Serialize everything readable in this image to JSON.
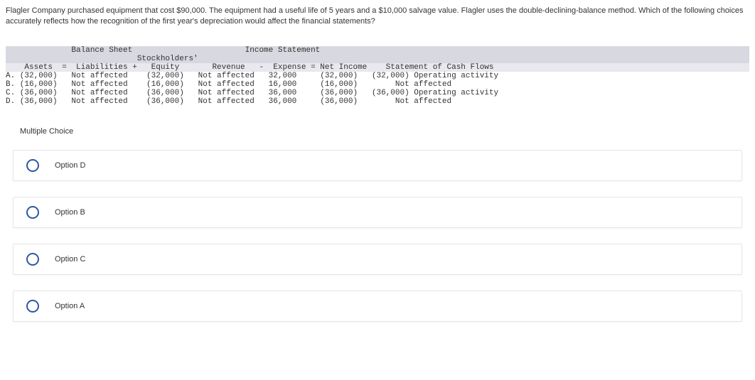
{
  "question": "Flagler Company purchased equipment that cost $90,000. The equipment had a useful life of 5 years and a $10,000 salvage value. Flagler uses the double-declining-balance method. Which of the following choices accurately reflects how the recognition of the first year's depreciation would affect the financial statements?",
  "table": {
    "header1": "              Balance Sheet                        Income Statement",
    "header2": "                            Stockholders'",
    "subheader": "    Assets  =  Liabilities +   Equity       Revenue   -  Expense = Net Income    Statement of Cash Flows",
    "rows": [
      "A. (32,000)   Not affected    (32,000)   Not affected   32,000     (32,000)   (32,000) Operating activity",
      "B. (16,000)   Not affected    (16,000)   Not affected   16,000     (16,000)        Not affected",
      "C. (36,000)   Not affected    (36,000)   Not affected   36,000     (36,000)   (36,000) Operating activity",
      "D. (36,000)   Not affected    (36,000)   Not affected   36,000     (36,000)        Not affected"
    ]
  },
  "mc_label": "Multiple Choice",
  "options": [
    {
      "label": "Option D"
    },
    {
      "label": "Option B"
    },
    {
      "label": "Option C"
    },
    {
      "label": "Option A"
    }
  ],
  "chart_data": {
    "type": "table",
    "title": "Effect of first year depreciation on financial statements",
    "columns": [
      "Option",
      "Assets",
      "Liabilities",
      "Stockholders' Equity",
      "Revenue",
      "Expense",
      "Net Income",
      "Statement of Cash Flows"
    ],
    "rows": [
      [
        "A",
        "(32,000)",
        "Not affected",
        "(32,000)",
        "Not affected",
        "32,000",
        "(32,000)",
        "(32,000) Operating activity"
      ],
      [
        "B",
        "(16,000)",
        "Not affected",
        "(16,000)",
        "Not affected",
        "16,000",
        "(16,000)",
        "Not affected"
      ],
      [
        "C",
        "(36,000)",
        "Not affected",
        "(36,000)",
        "Not affected",
        "36,000",
        "(36,000)",
        "(36,000) Operating activity"
      ],
      [
        "D",
        "(36,000)",
        "Not affected",
        "(36,000)",
        "Not affected",
        "36,000",
        "(36,000)",
        "Not affected"
      ]
    ]
  }
}
